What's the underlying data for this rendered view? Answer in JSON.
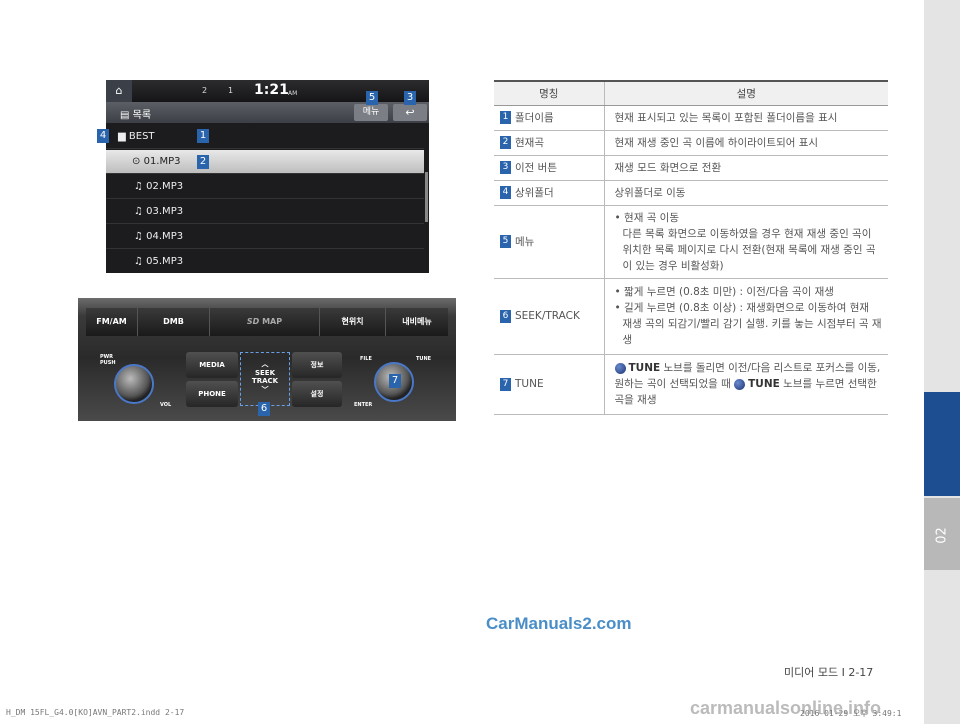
{
  "side_tab": {
    "label": "02"
  },
  "screen": {
    "home": "⌂",
    "indicators": [
      "2",
      "1"
    ],
    "time": "1:21",
    "ampm": "AM",
    "title": "▤ 목록",
    "menu_button": "메뉴",
    "back_button": "↩",
    "rows": [
      {
        "icon": "folder-icon",
        "text": "BEST"
      },
      {
        "icon": "play-icon",
        "text": "01.MP3"
      },
      {
        "icon": "music-note-icon",
        "text": "02.MP3"
      },
      {
        "icon": "music-note-icon",
        "text": "03.MP3"
      },
      {
        "icon": "music-note-icon",
        "text": "04.MP3"
      },
      {
        "icon": "music-note-icon",
        "text": "05.MP3"
      }
    ]
  },
  "callouts": [
    "1",
    "2",
    "3",
    "4",
    "5",
    "6",
    "7"
  ],
  "console": {
    "top_buttons": [
      "FM/AM",
      "DMB",
      "MAP",
      "현위치",
      "내비메뉴"
    ],
    "map_brand": "SD",
    "left_labels": [
      "PWR",
      "PUSH",
      "VOL"
    ],
    "center_buttons": [
      "MEDIA",
      "PHONE",
      "정보",
      "설정"
    ],
    "seek": [
      "SEEK",
      "TRACK"
    ],
    "right_labels": [
      "FILE",
      "TUNE",
      "ENTER"
    ]
  },
  "table": {
    "headers": [
      "명칭",
      "설명"
    ],
    "rows": [
      {
        "num": "1",
        "name": "폴더이름",
        "desc": [
          "현재 표시되고 있는 목록이 포함된 폴더이름을 표시"
        ]
      },
      {
        "num": "2",
        "name": "현재곡",
        "desc": [
          "현재 재생 중인 곡 이름에 하이라이트되어 표시"
        ]
      },
      {
        "num": "3",
        "name": "이전 버튼",
        "desc": [
          "재생 모드 화면으로 전환"
        ]
      },
      {
        "num": "4",
        "name": "상위폴더",
        "desc": [
          "상위폴더로 이동"
        ]
      },
      {
        "num": "5",
        "name": "메뉴",
        "desc": [
          "• 현재 곡 이동",
          "다른 목록 화면으로 이동하였을 경우 현재 재생 중인 곡이 위치한 목록 페이지로 다시 전환(현재 목록에 재생 중인 곡이 있는 경우 비활성화)"
        ]
      },
      {
        "num": "6",
        "name": "SEEK/TRACK",
        "desc": [
          "• 짧게 누르면 (0.8초 미만) : 이전/다음 곡이 재생",
          "• 길게 누르면 (0.8초 이상) : 재생화면으로 이동하여 현재 재생 곡의 되감기/빨리 감기 실행. 키를 놓는 시점부터 곡 재생"
        ]
      },
      {
        "num": "7",
        "name": "TUNE",
        "desc_tune": {
          "word": "TUNE",
          "part1": "노브를 돌리면 이전/다음 리스트로 포커스를 이동, 원하는 곡이 선택되었을 때",
          "part2": "노브를 누르면 선택한 곡을 재생"
        }
      }
    ]
  },
  "watermark": "CarManuals2.com",
  "footer": {
    "page": "미디어 모드 I 2-17",
    "file": "H_DM 15FL_G4.0[KO]AVN_PART2.indd   2-17",
    "date": "2016-01-29   오후 3:49:1",
    "site": "carmanualsonline.info"
  }
}
